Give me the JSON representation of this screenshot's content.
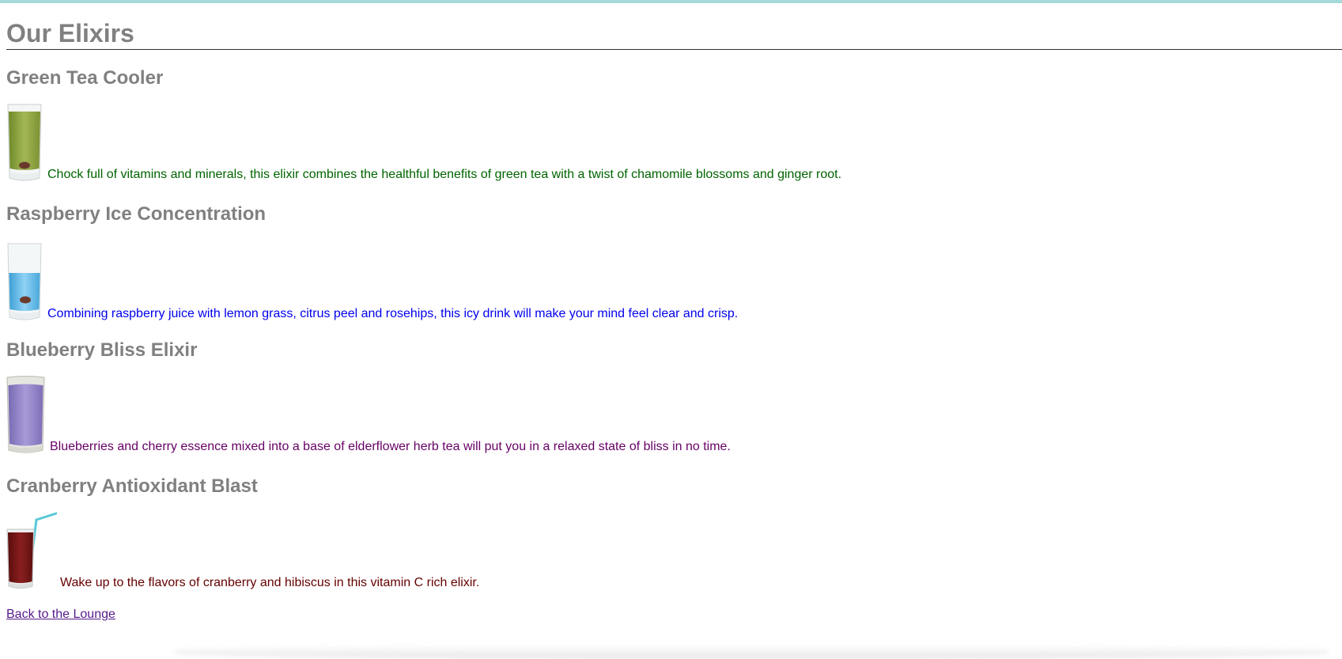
{
  "page": {
    "title": "Our Elixirs",
    "back_link": "Back to the Lounge"
  },
  "elixirs": [
    {
      "name": "Green Tea Cooler",
      "description": "Chock full of vitamins and minerals, this elixir combines the healthful benefits of green tea with a twist of chamomile blossoms and ginger root.",
      "color": "#006400"
    },
    {
      "name": "Raspberry Ice Concentration",
      "description": "Combining raspberry juice with lemon grass, citrus peel and rosehips, this icy drink will make your mind feel clear and crisp.",
      "color": "#0000ee"
    },
    {
      "name": "Blueberry Bliss Elixir",
      "description": "Blueberries and cherry essence mixed into a base of elderflower herb tea will put you in a relaxed state of bliss in no time.",
      "color": "#660066"
    },
    {
      "name": "Cranberry Antioxidant Blast",
      "description": "Wake up to the flavors of cranberry and hibiscus in this vitamin C rich elixir.",
      "color": "#660000"
    }
  ],
  "colors": {
    "heading": "#808080",
    "link": "#551a8b",
    "top_stripe": "#a6d9d9"
  }
}
